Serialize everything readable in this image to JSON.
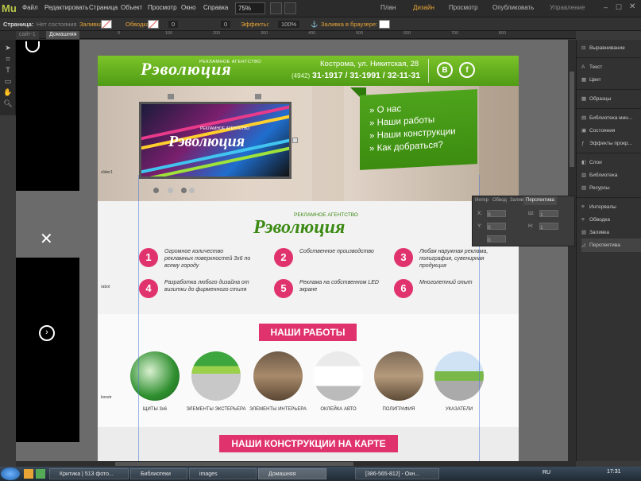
{
  "app": {
    "logo": "Mu"
  },
  "menu": [
    "Файл",
    "Редактировать",
    "Страница",
    "Объект",
    "Просмотр",
    "Окно",
    "Справка"
  ],
  "zoom": "75%",
  "modes": [
    "План",
    "Дизайн",
    "Просмотр",
    "Опубликовать",
    "Управление"
  ],
  "options": {
    "page_label": "Страница:",
    "state": "Нет состояния",
    "fill": "Заливка:",
    "stroke": "Обводка:",
    "stroke_value": "0",
    "stroke_value2": "0",
    "effects": "Эффекты:",
    "opacity": "100%",
    "browser_fill": "Заливка в браузере:"
  },
  "doc_tabs": [
    "сайт-1",
    "Домашняя"
  ],
  "ruler_ticks": [
    "0",
    "100",
    "200",
    "300",
    "400",
    "500",
    "600",
    "700",
    "800"
  ],
  "site": {
    "brand": "Рэволюция",
    "brand_sub": "РЕКЛАМНОЕ АГЕНТСТВО",
    "address": "Кострома, ул. Никитская, 28",
    "phone_code": "(4942)",
    "phones": "31-1917 / 31-1991 / 32-11-31",
    "social": [
      "В",
      "f"
    ],
    "nav": [
      "» О нас",
      "» Наши работы",
      "» Наши конструкции",
      "» Как добраться?"
    ],
    "slider_label": "slider1",
    "features": [
      {
        "n": "1",
        "text": "Огромное количество рекламных поверхностей 3х6 по всему городу"
      },
      {
        "n": "2",
        "text": "Собственное производство"
      },
      {
        "n": "3",
        "text": "Любая наружная реклама, полиграфия, сувенирная продукция"
      },
      {
        "n": "4",
        "text": "Разработка любого дизайна от визитки до фирменного стиля"
      },
      {
        "n": "5",
        "text": "Реклама на собственном LED экране"
      },
      {
        "n": "6",
        "text": "Многолетний опыт"
      }
    ],
    "features_label": "rabot",
    "works_heading": "НАШИ РАБОТЫ",
    "works_label": "konstr",
    "works": [
      "ЩИТЫ 3х6",
      "ЭЛЕМЕНТЫ ЭКСТЕРЬЕРА",
      "ЭЛЕМЕНТЫ ИНТЕРЬЕРА",
      "ОКЛЕЙКА АВТО",
      "ПОЛИГРАФИЯ",
      "УКАЗАТЕЛИ"
    ],
    "map_heading": "НАШИ КОНСТРУКЦИИ НА КАРТЕ"
  },
  "perspective_panel": {
    "tabs": [
      "Интер",
      "Обвод",
      "Залив",
      "Перспектива"
    ],
    "x_label": "X:",
    "y_label": "Y:",
    "w_label": "Ш:",
    "h_label": "H:",
    "x": "0",
    "y": "0",
    "w": "1",
    "h": "1",
    "rot": "0"
  },
  "right_panel": [
    "Выравнивание",
    "Текст",
    "Цвет",
    "Образцы",
    "Библиотека мин...",
    "Состояния",
    "Эффекты прокр...",
    "Слои",
    "Библиотека",
    "Ресурсы",
    "Интервалы",
    "Обводка",
    "Заливка",
    "Перспектива"
  ],
  "taskbar": {
    "items": [
      "Критика | 513 фото...",
      "Библиотеки",
      "images",
      "Домашняя",
      "[386-565-812] - Окн..."
    ],
    "lang": "RU",
    "clock": "17:31"
  },
  "colors": {
    "accent_pink": "#e0336e",
    "brand_green": "#4f9b15",
    "ui_orange": "#e8a536"
  }
}
